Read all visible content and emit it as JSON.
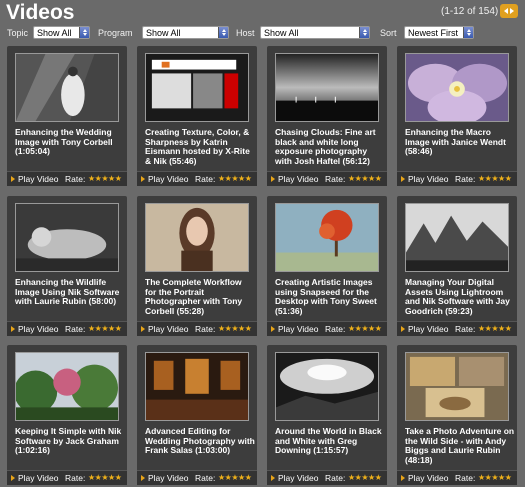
{
  "header": {
    "title": "Videos",
    "pager_text": "(1-12 of 154)"
  },
  "filters": {
    "topic_label": "Topic",
    "topic_value": "Show All",
    "program_label": "Program",
    "program_value": "Show All",
    "host_label": "Host",
    "host_value": "Show All",
    "sort_label": "Sort",
    "sort_value": "Newest First"
  },
  "cards": [
    {
      "title": "Enhancing the Wedding Image with Tony Corbell (1:05:04)",
      "play_label": "Play Video",
      "rate_label": "Rate:",
      "stars": "★★★★★"
    },
    {
      "title": "Creating Texture, Color, & Sharpness by Katrin Eismann hosted by X-Rite & Nik (55:46)",
      "play_label": "Play Video",
      "rate_label": "Rate:",
      "stars": "★★★★★",
      "thumb_text": "x·rite"
    },
    {
      "title": "Chasing Clouds: Fine art black and white long exposure photography with Josh Haftel (56:12)",
      "play_label": "Play Video",
      "rate_label": "Rate:",
      "stars": "★★★★★"
    },
    {
      "title": "Enhancing the Macro Image with Janice Wendt (58:46)",
      "play_label": "Play Video",
      "rate_label": "Rate:",
      "stars": "★★★★★"
    },
    {
      "title": "Enhancing the Wildlife Image Using Nik Software with Laurie Rubin (58:00)",
      "play_label": "Play Video",
      "rate_label": "Rate:",
      "stars": "★★★★★"
    },
    {
      "title": "The Complete Workflow for the Portrait Photographer with Tony Corbell (55:28)",
      "play_label": "Play Video",
      "rate_label": "Rate:",
      "stars": "★★★★★"
    },
    {
      "title": "Creating Artistic Images using Snapseed for the Desktop with Tony Sweet (51:36)",
      "play_label": "Play Video",
      "rate_label": "Rate:",
      "stars": "★★★★★"
    },
    {
      "title": "Managing Your Digital Assets Using Lightroom and Nik Software with Jay Goodrich (59:23)",
      "play_label": "Play Video",
      "rate_label": "Rate:",
      "stars": "★★★★★"
    },
    {
      "title": "Keeping It Simple with Nik Software by Jack Graham (1:02:16)",
      "play_label": "Play Video",
      "rate_label": "Rate:",
      "stars": "★★★★★"
    },
    {
      "title": "Advanced Editing for Wedding Photography with Frank Salas (1:03:00)",
      "play_label": "Play Video",
      "rate_label": "Rate:",
      "stars": "★★★★★"
    },
    {
      "title": "Around the World in Black and White with Greg Downing (1:15:57)",
      "play_label": "Play Video",
      "rate_label": "Rate:",
      "stars": "★★★★★"
    },
    {
      "title": "Take a Photo Adventure on the Wild Side - with Andy Biggs and Laurie Rubin (48:18)",
      "play_label": "Play Video",
      "rate_label": "Rate:",
      "stars": "★★★★★"
    }
  ],
  "colors": {
    "background": "#6a6a6a",
    "card": "#3d3d3d",
    "accent": "#e8a418",
    "star": "#f0b21a"
  }
}
